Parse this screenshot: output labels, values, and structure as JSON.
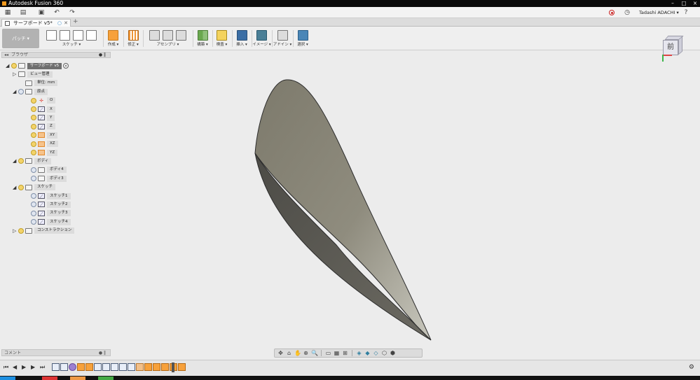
{
  "window": {
    "title": "Autodesk Fusion 360",
    "controls": [
      "–",
      "□",
      "×"
    ]
  },
  "quick_access": {
    "icons": [
      "grid-icon",
      "file-icon",
      "save-icon",
      "undo-icon",
      "redo-icon"
    ],
    "user": "Tadashi ADACHI ▾",
    "help": "?"
  },
  "document_tab": {
    "label": "サーフボード v5*",
    "close": "✕",
    "add": "+"
  },
  "toolbar": {
    "workspace": "パッチ ▾",
    "groups": [
      {
        "label": "スケッチ ▾",
        "icons": [
          "outline",
          "outline",
          "outline",
          "outline"
        ]
      },
      {
        "label": "作成 ▾",
        "icons": [
          "orange"
        ]
      },
      {
        "label": "修正 ▾",
        "icons": [
          "stripe"
        ]
      },
      {
        "label": "アセンブリ ▾",
        "icons": [
          "gray",
          "gray",
          "gray"
        ]
      },
      {
        "label": "構築 ▾",
        "icons": [
          "green"
        ]
      },
      {
        "label": "検査 ▾",
        "icons": [
          "yellow"
        ]
      },
      {
        "label": "挿入 ▾",
        "icons": [
          "blue"
        ]
      },
      {
        "label": "イメージ ▾",
        "icons": [
          "teal"
        ]
      },
      {
        "label": "アドイン ▾",
        "icons": [
          "gray"
        ]
      },
      {
        "label": "選択 ▾",
        "icons": [
          "active"
        ]
      }
    ]
  },
  "viewcube": {
    "face": "前"
  },
  "browser": {
    "title": "ブラウザ",
    "nodes": [
      {
        "label": "サーフボード v5",
        "type": "root",
        "tri": "◢",
        "bulb": "on",
        "glyph": "folder"
      },
      {
        "label": "ビュー管理",
        "tri": "▷",
        "bulb": "none",
        "glyph": "folder"
      },
      {
        "label": "単位: mm",
        "tri": "",
        "bulb": "none",
        "glyph": "doc"
      },
      {
        "label": "原点",
        "tri": "◢",
        "bulb": "off",
        "glyph": "folder"
      },
      {
        "label": "O",
        "tri": "",
        "bulb": "on",
        "glyph": "origin"
      },
      {
        "label": "X",
        "tri": "",
        "bulb": "on",
        "glyph": "axis"
      },
      {
        "label": "Y",
        "tri": "",
        "bulb": "on",
        "glyph": "axis"
      },
      {
        "label": "Z",
        "tri": "",
        "bulb": "on",
        "glyph": "axis"
      },
      {
        "label": "XY",
        "tri": "",
        "bulb": "on",
        "glyph": "plane"
      },
      {
        "label": "XZ",
        "tri": "",
        "bulb": "on",
        "glyph": "plane"
      },
      {
        "label": "YZ",
        "tri": "",
        "bulb": "on",
        "glyph": "plane"
      },
      {
        "label": "ボディ",
        "tri": "◢",
        "bulb": "on",
        "glyph": "folder"
      },
      {
        "label": "ボディ4",
        "tri": "",
        "bulb": "off",
        "glyph": "body"
      },
      {
        "label": "ボディ3",
        "tri": "",
        "bulb": "off",
        "glyph": "body"
      },
      {
        "label": "スケッチ",
        "tri": "◢",
        "bulb": "on",
        "glyph": "folder"
      },
      {
        "label": "スケッチ1",
        "tri": "",
        "bulb": "off",
        "glyph": "sketch"
      },
      {
        "label": "スケッチ2",
        "tri": "",
        "bulb": "off",
        "glyph": "sketch"
      },
      {
        "label": "スケッチ3",
        "tri": "",
        "bulb": "off",
        "glyph": "sketch"
      },
      {
        "label": "スケッチ4",
        "tri": "",
        "bulb": "off",
        "glyph": "sketch"
      },
      {
        "label": "コンストラクション",
        "tri": "▷",
        "bulb": "on",
        "glyph": "folder"
      }
    ]
  },
  "comments": {
    "title": "コメント"
  },
  "navbar": {
    "icons": [
      "orbit-icon",
      "look-at-icon",
      "pan-icon",
      "zoom-window-icon",
      "zoom-icon",
      "display-settings-icon",
      "grid-settings-icon",
      "viewport-layout-icon",
      "home-icon",
      "front-view-icon",
      "top-view-icon",
      "right-view-icon",
      "iso-view-icon"
    ]
  },
  "timeline": {
    "controls": [
      "⏮",
      "◀",
      "▶",
      "▶",
      "⏭"
    ],
    "features": [
      "sk",
      "sk",
      "pu",
      "ex",
      "ex",
      "sk",
      "sk",
      "sk",
      "sk",
      "sk",
      "lo",
      "ex",
      "ex",
      "ex",
      "ex",
      "ex"
    ]
  },
  "colors": {
    "accent": "#4a86b7",
    "surface_light": "#8a8676",
    "surface_dark": "#5a5953",
    "background": "#ececec"
  }
}
